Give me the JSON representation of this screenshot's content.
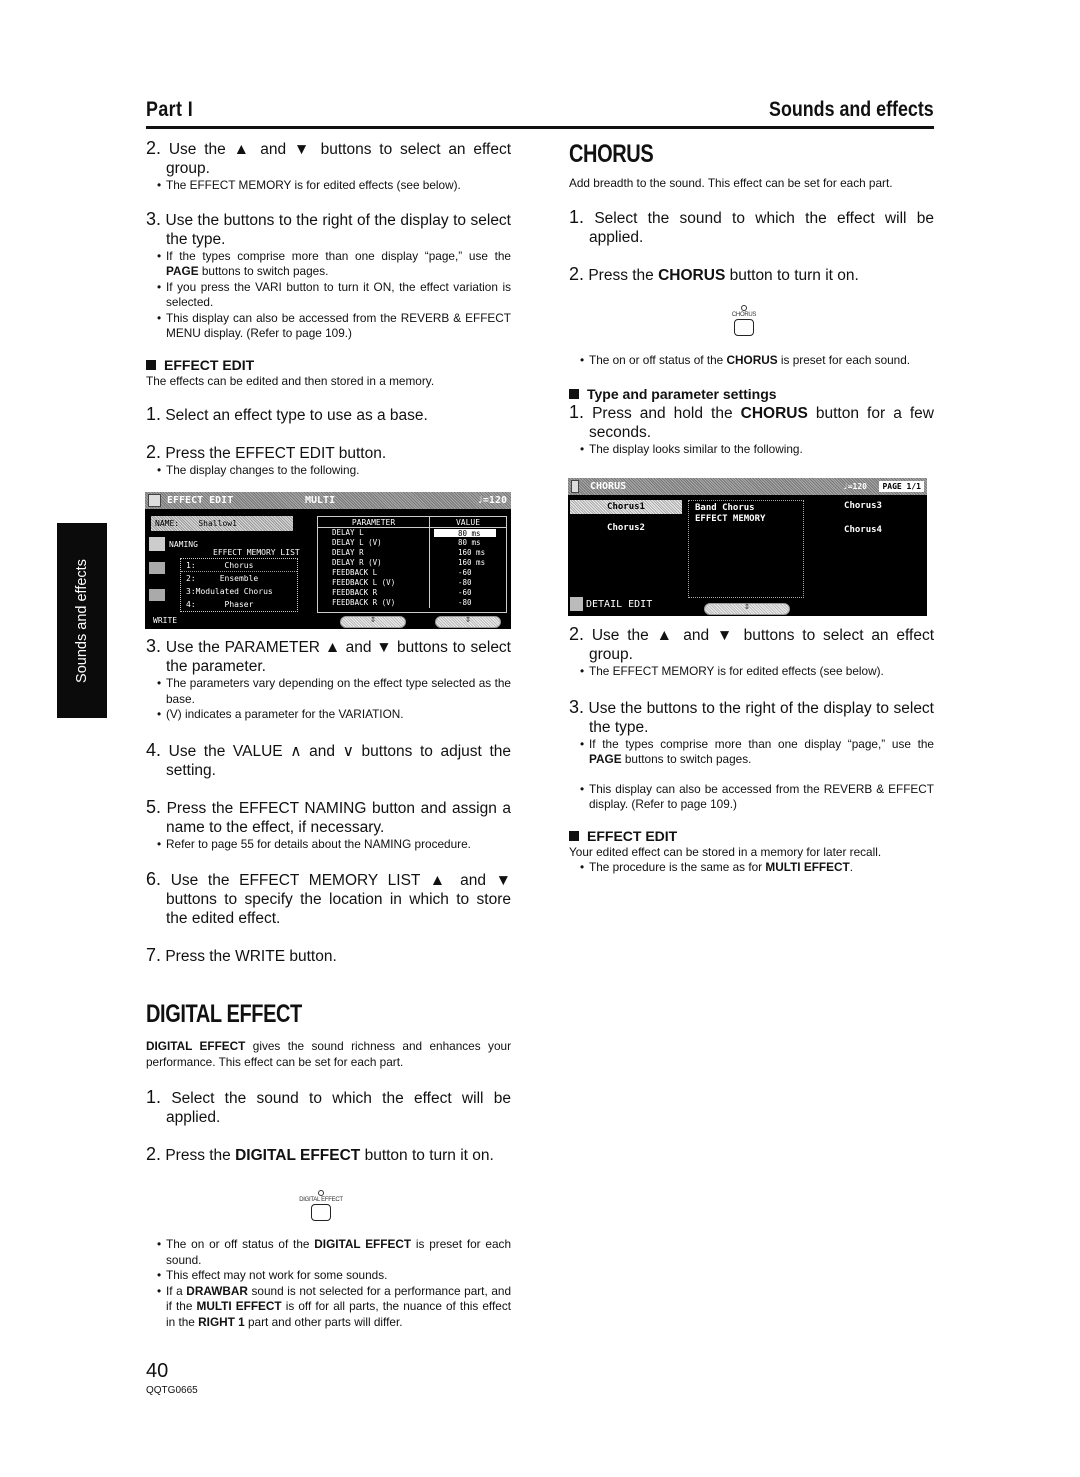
{
  "header": {
    "part": "Part I",
    "section": "Sounds and effects"
  },
  "side_tab": "Sounds and effects",
  "left": {
    "s2": {
      "num": "2.",
      "text": "Use the ▲ and ▼ buttons to select an effect group."
    },
    "s2_b1": "The EFFECT MEMORY is for edited effects (see below).",
    "s3": {
      "num": "3.",
      "text": "Use the buttons to the right of the display to select the type."
    },
    "s3_b1_pre": "If the types comprise more than one display “page,” use the ",
    "s3_b1_bold": "PAGE",
    "s3_b1_post": " buttons to switch pages.",
    "s3_b2": "If you press the VARI button to turn it ON, the effect variation is selected.",
    "s3_b3": "This display can also be accessed from the REVERB & EFFECT MENU display. (Refer to page 109.)",
    "edit_head": "EFFECT EDIT",
    "edit_intro": "The effects can be edited and then stored in a memory.",
    "e1": {
      "num": "1.",
      "text": "Select an effect type to use as a base."
    },
    "e2": {
      "num": "2.",
      "text": "Press the EFFECT EDIT button."
    },
    "e2_b1": "The display changes to the following.",
    "e3": {
      "num": "3.",
      "text": "Use the PARAMETER ▲ and ▼ buttons to select the parameter."
    },
    "e3_b1": "The parameters vary depending on the effect type selected as the base.",
    "e3_b2": "(V) indicates a parameter for the VARIATION.",
    "e4": {
      "num": "4.",
      "text": "Use the VALUE ∧ and ∨ buttons to adjust the setting."
    },
    "e5": {
      "num": "5.",
      "text": "Press the EFFECT NAMING button and assign a name to the effect, if necessary."
    },
    "e5_b1": "Refer to page 55 for details about the NAMING procedure.",
    "e6": {
      "num": "6.",
      "text": "Use the EFFECT MEMORY LIST ▲ and ▼ buttons to specify the location in which to store the edited effect."
    },
    "e7": {
      "num": "7.",
      "text": "Press the WRITE button."
    },
    "digital_title": "DIGITAL EFFECT",
    "digital_intro_bold": "DIGITAL EFFECT",
    "digital_intro": " gives the sound richness and enhances your performance. This effect can be set for each part.",
    "d1": {
      "num": "1.",
      "text": "Select the sound to which the effect will be applied."
    },
    "d2": {
      "num": "2.",
      "pre": "Press the ",
      "bold": "DIGITAL EFFECT",
      "post": " button to turn it on."
    },
    "d_button_label": "DIGITAL EFFECT",
    "d_b1_pre": "The on or off status of the ",
    "d_b1_bold": "DIGITAL EFFECT",
    "d_b1_post": " is preset for each sound.",
    "d_b2": "This effect may not work for some sounds.",
    "d_b3_1": "If a ",
    "d_b3_2": "DRAWBAR",
    "d_b3_3": " sound is not selected for a performance part, and if the ",
    "d_b3_4": "MULTI EFFECT",
    "d_b3_5": " is off for all parts, the nuance of this effect in the ",
    "d_b3_6": "RIGHT 1",
    "d_b3_7": " part and other parts will differ."
  },
  "effect_edit_screen": {
    "title": "EFFECT EDIT",
    "mode": "MULTI",
    "tempo": "♩=120",
    "name_label": "NAME:",
    "name_value": "Shallow1",
    "naming": "NAMING",
    "memory_list_label": "EFFECT MEMORY LIST",
    "memory_list": [
      "1:      Chorus",
      "2:     Ensemble",
      "3:Modulated Chorus",
      "4:      Phaser"
    ],
    "write": "WRITE",
    "param_header": "PARAMETER",
    "value_header": "VALUE",
    "params": [
      {
        "name": "DELAY L",
        "value": "80 ms"
      },
      {
        "name": "DELAY L (V)",
        "value": "80 ms"
      },
      {
        "name": "DELAY R",
        "value": "160 ms"
      },
      {
        "name": "DELAY R (V)",
        "value": "160 ms"
      },
      {
        "name": "FEEDBACK L",
        "value": "-60"
      },
      {
        "name": "FEEDBACK L (V)",
        "value": "-80"
      },
      {
        "name": "FEEDBACK R",
        "value": "-60"
      },
      {
        "name": "FEEDBACK R (V)",
        "value": "-80"
      }
    ]
  },
  "right": {
    "chorus_title": "CHORUS",
    "chorus_intro": "Add breadth to the sound. This effect can be set for each part.",
    "c1": {
      "num": "1.",
      "text": "Select the sound to which the effect will be applied."
    },
    "c2": {
      "num": "2.",
      "pre": "Press the ",
      "bold": "CHORUS",
      "post": " button to turn it on."
    },
    "c_button_label": "CHORUS",
    "c_b1_pre": "The on or off status of the ",
    "c_b1_bold": "CHORUS",
    "c_b1_post": " is preset for each sound.",
    "type_head": "Type and parameter settings",
    "t1": {
      "num": "1.",
      "pre": "Press and hold the ",
      "bold": "CHORUS",
      "post": " button for a few seconds."
    },
    "t1_b1": "The display looks similar to the following.",
    "t2": {
      "num": "2.",
      "text": "Use the ▲ and ▼ buttons to select an effect group."
    },
    "t2_b1": "The EFFECT MEMORY is for edited effects (see below).",
    "t3": {
      "num": "3.",
      "text": "Use the buttons to the right of the display to select the type."
    },
    "t3_b1_pre": "If the types comprise more than one display “page,” use the ",
    "t3_b1_bold": "PAGE",
    "t3_b1_post": " buttons to switch pages.",
    "t3_b2": "This display can also be accessed from the REVERB & EFFECT display. (Refer to page 109.)",
    "edit_head": "EFFECT EDIT",
    "edit_intro": "Your edited effect can be stored in a memory for later recall.",
    "edit_b1_pre": "The procedure is the same as for ",
    "edit_b1_bold": "MULTI EFFECT",
    "edit_b1_post": "."
  },
  "chorus_screen": {
    "title": "CHORUS",
    "tempo": "♩=120",
    "page": "PAGE 1/1",
    "types_left": [
      "Chorus1",
      "Chorus2"
    ],
    "groups": [
      "Band Chorus",
      "EFFECT MEMORY"
    ],
    "types_right": [
      "Chorus3",
      "Chorus4"
    ],
    "detail_edit": "DETAIL EDIT"
  },
  "footer": {
    "page_number": "40",
    "code": "QQTG0665"
  }
}
